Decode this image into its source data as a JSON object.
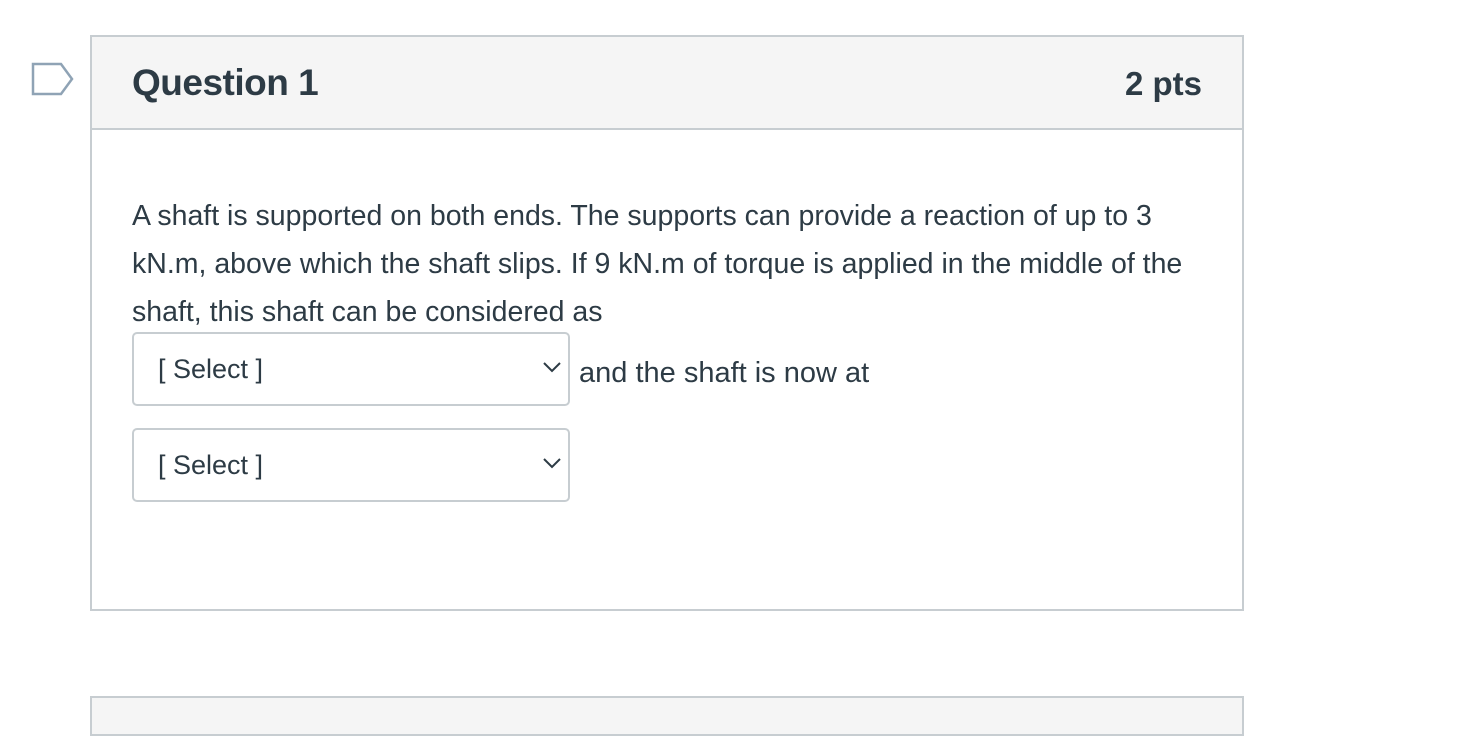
{
  "question": {
    "title": "Question 1",
    "points": "2 pts",
    "text": "A shaft is supported on both ends. The supports can provide a reaction of up to 3 kN.m, above which the shaft slips. If 9 kN.m of torque is applied in the middle of the shaft, this shaft can be considered as",
    "dropdowns": [
      {
        "selected": "[ Select ]",
        "after_text": "and the shaft is now at"
      },
      {
        "selected": "[ Select ]",
        "after_text": ""
      }
    ]
  },
  "icons": {
    "flag": "flag-question-icon",
    "chevron": "chevron-down-icon"
  },
  "colors": {
    "text": "#2d3b45",
    "border": "#c7cdd1",
    "header_bg": "#f5f5f5",
    "flag": "#8fa3b5"
  }
}
